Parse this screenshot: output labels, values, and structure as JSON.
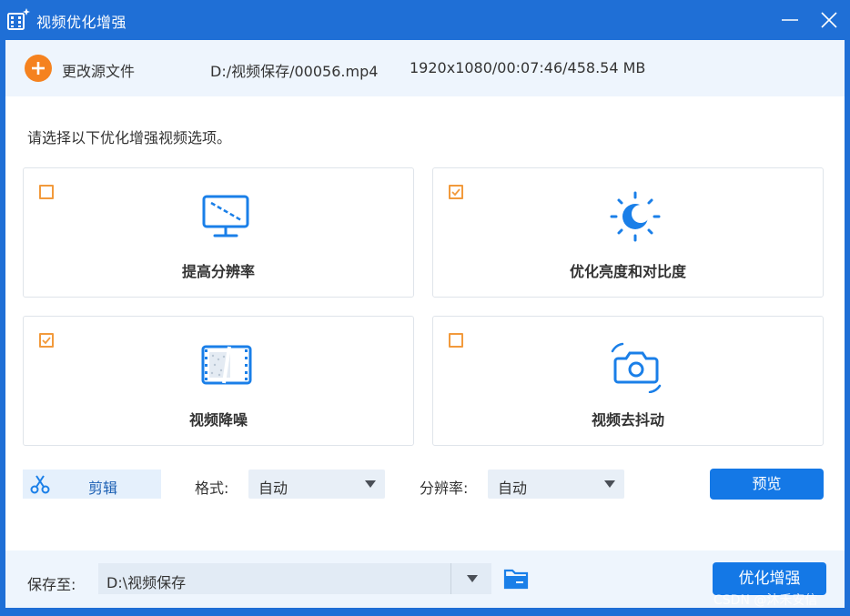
{
  "window": {
    "title": "视频优化增强",
    "accent": "#1f6fd6",
    "minimize_icon": "minimize-icon",
    "close_icon": "close-icon"
  },
  "source": {
    "change_label": "更改源文件",
    "path": "D:/视频保存/00056.mp4",
    "info": "1920x1080/00:07:46/458.54 MB"
  },
  "prompt": "请选择以下优化增强视频选项。",
  "options": [
    {
      "label": "提高分辨率",
      "checked": false,
      "icon": "monitor-resolution-icon"
    },
    {
      "label": "优化亮度和对比度",
      "checked": true,
      "icon": "brightness-icon"
    },
    {
      "label": "视频降噪",
      "checked": true,
      "icon": "film-noise-icon"
    },
    {
      "label": "视频去抖动",
      "checked": false,
      "icon": "camera-shake-icon"
    }
  ],
  "controls": {
    "cut_label": "剪辑",
    "format_label": "格式:",
    "format_value": "自动",
    "resolution_label": "分辨率:",
    "resolution_value": "自动",
    "preview_label": "预览"
  },
  "save": {
    "label": "保存至:",
    "path": "D:\\视频保存",
    "enhance_label": "优化增强"
  },
  "watermark": "CSDN @沐禾安信",
  "colors": {
    "checkbox": "#f29a3c",
    "primary_button": "#1478e6",
    "icon_blue": "#1a7fe8"
  }
}
